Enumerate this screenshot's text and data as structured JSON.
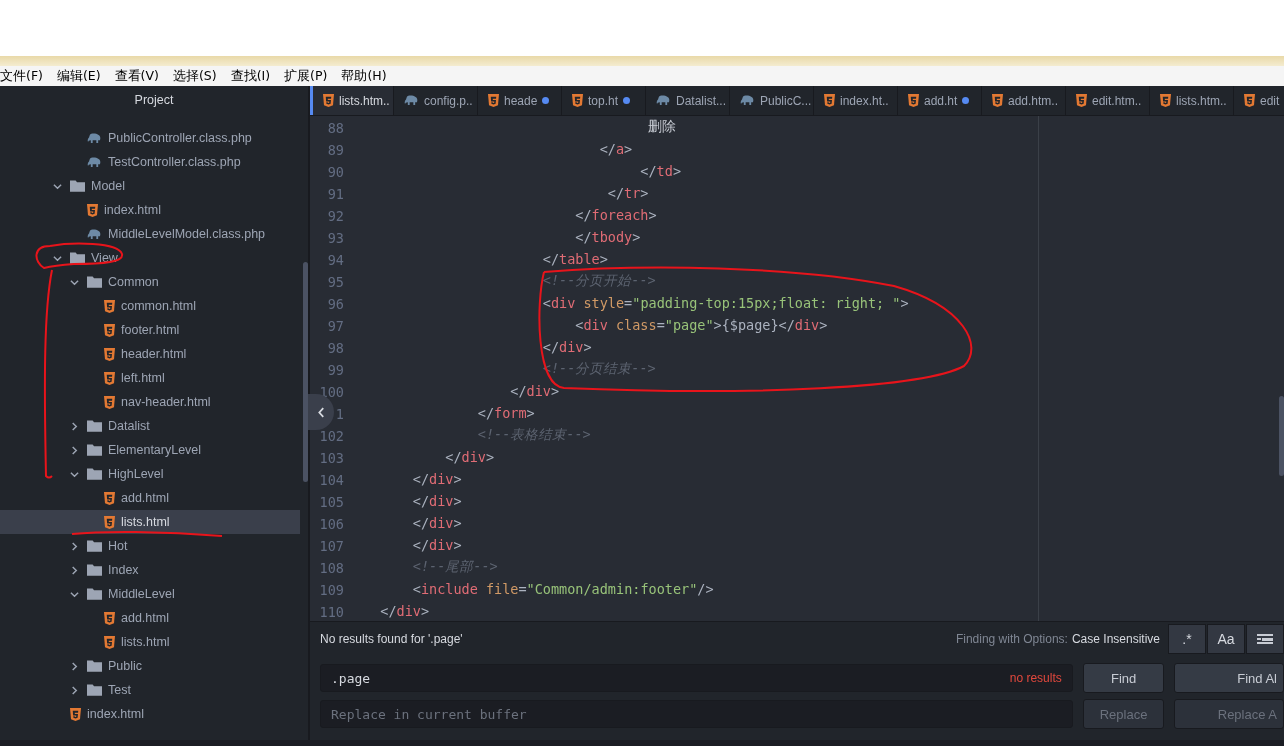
{
  "menu": [
    {
      "label": "文件(F)"
    },
    {
      "label": "编辑(E)"
    },
    {
      "label": "查看(V)"
    },
    {
      "label": "选择(S)"
    },
    {
      "label": "查找(I)"
    },
    {
      "label": "扩展(P)"
    },
    {
      "label": "帮助(H)"
    }
  ],
  "sidebar": {
    "title": "Project",
    "continued_items": [
      {
        "name": "PublicController.class.php",
        "kind": "php",
        "selected": false
      },
      {
        "name": "TestController.class.php",
        "kind": "php",
        "selected": false
      }
    ],
    "tree": [
      {
        "name": "Model",
        "kind": "folder",
        "expanded": true,
        "selected": false,
        "children": [
          {
            "name": "index.html",
            "kind": "html",
            "selected": false
          },
          {
            "name": "MiddleLevelModel.class.php",
            "kind": "php",
            "selected": false
          }
        ]
      },
      {
        "name": "View",
        "kind": "folder",
        "expanded": true,
        "selected": false,
        "children": [
          {
            "name": "Common",
            "kind": "folder",
            "expanded": true,
            "selected": false,
            "children": [
              {
                "name": "common.html",
                "kind": "html",
                "selected": false
              },
              {
                "name": "footer.html",
                "kind": "html",
                "selected": false
              },
              {
                "name": "header.html",
                "kind": "html",
                "selected": false
              },
              {
                "name": "left.html",
                "kind": "html",
                "selected": false
              },
              {
                "name": "nav-header.html",
                "kind": "html",
                "selected": false
              }
            ]
          },
          {
            "name": "Datalist",
            "kind": "folder",
            "expanded": false,
            "selected": false
          },
          {
            "name": "ElementaryLevel",
            "kind": "folder",
            "expanded": false,
            "selected": false
          },
          {
            "name": "HighLevel",
            "kind": "folder",
            "expanded": true,
            "selected": false,
            "children": [
              {
                "name": "add.html",
                "kind": "html",
                "selected": false
              },
              {
                "name": "lists.html",
                "kind": "html",
                "selected": true
              }
            ]
          },
          {
            "name": "Hot",
            "kind": "folder",
            "expanded": false,
            "selected": false
          },
          {
            "name": "Index",
            "kind": "folder",
            "expanded": false,
            "selected": false
          },
          {
            "name": "MiddleLevel",
            "kind": "folder",
            "expanded": true,
            "selected": false,
            "children": [
              {
                "name": "add.html",
                "kind": "html",
                "selected": false
              },
              {
                "name": "lists.html",
                "kind": "html",
                "selected": false
              }
            ]
          },
          {
            "name": "Public",
            "kind": "folder",
            "expanded": false,
            "selected": false
          },
          {
            "name": "Test",
            "kind": "folder",
            "expanded": false,
            "selected": false
          }
        ]
      },
      {
        "name": "index.html",
        "kind": "html",
        "selected": false
      }
    ]
  },
  "tabs": [
    {
      "label": "lists.htm..",
      "kind": "html",
      "modified": false,
      "selected": true
    },
    {
      "label": "config.p..",
      "kind": "php",
      "modified": false,
      "selected": false
    },
    {
      "label": "heade",
      "kind": "html",
      "modified": true,
      "selected": false
    },
    {
      "label": "top.ht",
      "kind": "html",
      "modified": true,
      "selected": false
    },
    {
      "label": "Datalist...",
      "kind": "php",
      "modified": false,
      "selected": false
    },
    {
      "label": "PublicC...",
      "kind": "php",
      "modified": false,
      "selected": false
    },
    {
      "label": "index.ht..",
      "kind": "html",
      "modified": false,
      "selected": false
    },
    {
      "label": "add.ht",
      "kind": "html",
      "modified": true,
      "selected": false
    },
    {
      "label": "add.htm..",
      "kind": "html",
      "modified": false,
      "selected": false
    },
    {
      "label": "edit.htm..",
      "kind": "html",
      "modified": false,
      "selected": false
    },
    {
      "label": "lists.htm..",
      "kind": "html",
      "modified": false,
      "selected": false
    },
    {
      "label": "edit",
      "kind": "html",
      "modified": false,
      "selected": false
    }
  ],
  "code_lines": [
    {
      "number": "88",
      "tokens": [
        {
          "kind": "text",
          "text": "                                   删除"
        }
      ]
    },
    {
      "number": "89",
      "tokens": [
        {
          "kind": "punct",
          "text": "                             </"
        },
        {
          "kind": "tag",
          "text": "a"
        },
        {
          "kind": "punct",
          "text": ">"
        }
      ]
    },
    {
      "number": "90",
      "tokens": [
        {
          "kind": "punct",
          "text": "                                  </"
        },
        {
          "kind": "tag",
          "text": "td"
        },
        {
          "kind": "punct",
          "text": ">"
        }
      ]
    },
    {
      "number": "91",
      "tokens": [
        {
          "kind": "punct",
          "text": "                              </"
        },
        {
          "kind": "tag",
          "text": "tr"
        },
        {
          "kind": "punct",
          "text": ">"
        }
      ]
    },
    {
      "number": "92",
      "tokens": [
        {
          "kind": "punct",
          "text": "                          </"
        },
        {
          "kind": "tag",
          "text": "foreach"
        },
        {
          "kind": "punct",
          "text": ">"
        }
      ]
    },
    {
      "number": "93",
      "tokens": [
        {
          "kind": "punct",
          "text": "                          </"
        },
        {
          "kind": "tag",
          "text": "tbody"
        },
        {
          "kind": "punct",
          "text": ">"
        }
      ]
    },
    {
      "number": "94",
      "tokens": [
        {
          "kind": "punct",
          "text": "                      </"
        },
        {
          "kind": "tag",
          "text": "table"
        },
        {
          "kind": "punct",
          "text": ">"
        }
      ]
    },
    {
      "number": "95",
      "tokens": [
        {
          "kind": "comment",
          "text": "                      <!--分页开始-->"
        }
      ]
    },
    {
      "number": "96",
      "tokens": [
        {
          "kind": "punct",
          "text": "                      <"
        },
        {
          "kind": "tag",
          "text": "div"
        },
        {
          "kind": "attr",
          "text": " style"
        },
        {
          "kind": "punct",
          "text": "="
        },
        {
          "kind": "string",
          "text": "\"padding-top:15px;float: right; \""
        },
        {
          "kind": "punct",
          "text": ">"
        }
      ]
    },
    {
      "number": "97",
      "tokens": [
        {
          "kind": "punct",
          "text": "                          <"
        },
        {
          "kind": "tag",
          "text": "div"
        },
        {
          "kind": "attr",
          "text": " class"
        },
        {
          "kind": "punct",
          "text": "="
        },
        {
          "kind": "string",
          "text": "\"page\""
        },
        {
          "kind": "punct",
          "text": ">{$page}</"
        },
        {
          "kind": "tag",
          "text": "div"
        },
        {
          "kind": "punct",
          "text": ">"
        }
      ]
    },
    {
      "number": "98",
      "tokens": [
        {
          "kind": "punct",
          "text": "                      </"
        },
        {
          "kind": "tag",
          "text": "div"
        },
        {
          "kind": "punct",
          "text": ">"
        }
      ]
    },
    {
      "number": "99",
      "tokens": [
        {
          "kind": "comment",
          "text": "                      <!--分页结束-->"
        }
      ]
    },
    {
      "number": "100",
      "tokens": [
        {
          "kind": "punct",
          "text": "                  </"
        },
        {
          "kind": "tag",
          "text": "div"
        },
        {
          "kind": "punct",
          "text": ">"
        }
      ]
    },
    {
      "number": "1",
      "tokens": [
        {
          "kind": "punct",
          "text": "              </"
        },
        {
          "kind": "tag",
          "text": "form"
        },
        {
          "kind": "punct",
          "text": ">"
        }
      ]
    },
    {
      "number": "102",
      "tokens": [
        {
          "kind": "comment",
          "text": "              <!--表格结束-->"
        }
      ]
    },
    {
      "number": "103",
      "tokens": [
        {
          "kind": "punct",
          "text": "          </"
        },
        {
          "kind": "tag",
          "text": "div"
        },
        {
          "kind": "punct",
          "text": ">"
        }
      ]
    },
    {
      "number": "104",
      "tokens": [
        {
          "kind": "punct",
          "text": "      </"
        },
        {
          "kind": "tag",
          "text": "div"
        },
        {
          "kind": "punct",
          "text": ">"
        }
      ]
    },
    {
      "number": "105",
      "tokens": [
        {
          "kind": "punct",
          "text": "      </"
        },
        {
          "kind": "tag",
          "text": "div"
        },
        {
          "kind": "punct",
          "text": ">"
        }
      ]
    },
    {
      "number": "106",
      "tokens": [
        {
          "kind": "punct",
          "text": "      </"
        },
        {
          "kind": "tag",
          "text": "div"
        },
        {
          "kind": "punct",
          "text": ">"
        }
      ]
    },
    {
      "number": "107",
      "tokens": [
        {
          "kind": "punct",
          "text": "      </"
        },
        {
          "kind": "tag",
          "text": "div"
        },
        {
          "kind": "punct",
          "text": ">"
        }
      ]
    },
    {
      "number": "108",
      "tokens": [
        {
          "kind": "comment",
          "text": "      <!--尾部-->"
        }
      ]
    },
    {
      "number": "109",
      "tokens": [
        {
          "kind": "punct",
          "text": "      <"
        },
        {
          "kind": "tag",
          "text": "include"
        },
        {
          "kind": "attr",
          "text": " file"
        },
        {
          "kind": "punct",
          "text": "="
        },
        {
          "kind": "string",
          "text": "\"Common/admin:footer\""
        },
        {
          "kind": "punct",
          "text": "/>"
        }
      ]
    },
    {
      "number": "110",
      "tokens": [
        {
          "kind": "punct",
          "text": "  </"
        },
        {
          "kind": "tag",
          "text": "div"
        },
        {
          "kind": "punct",
          "text": ">"
        }
      ]
    }
  ],
  "find_panel": {
    "status": "No results found for '.page'",
    "options_label": "Finding with Options:",
    "options_value": "Case Insensitive",
    "option_buttons": [
      {
        "kind": "regex",
        "label": ".*",
        "selected": false
      },
      {
        "kind": "case",
        "label": "Aa",
        "selected": false
      },
      {
        "kind": "selection",
        "selected": false
      }
    ],
    "find_field": {
      "value": ".page",
      "result": "no results"
    },
    "replace_field": {
      "placeholder": "Replace in current buffer"
    },
    "find_buttons": [
      {
        "label": "Find",
        "disabled": false
      },
      {
        "label": "Find Al",
        "disabled": false
      }
    ],
    "replace_buttons": [
      {
        "label": "Replace",
        "disabled": true
      },
      {
        "label": "Replace A",
        "disabled": true
      }
    ]
  }
}
